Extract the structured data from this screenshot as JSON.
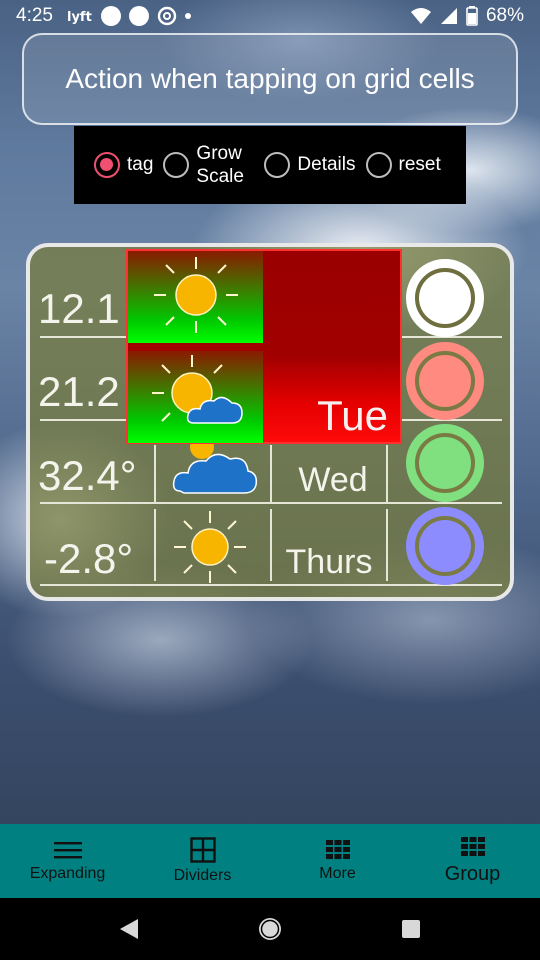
{
  "status_bar": {
    "time": "4:25",
    "battery": "68%",
    "icons": [
      "lyft-icon",
      "circle-icon",
      "circle-icon",
      "at-icon",
      "dot-icon",
      "wifi-icon",
      "signal-icon",
      "battery-icon"
    ]
  },
  "header": {
    "title": "Action when tapping on grid cells"
  },
  "actions": {
    "options": [
      {
        "label": "tag",
        "checked": true
      },
      {
        "label": "Grow Scale",
        "checked": false
      },
      {
        "label": "Details",
        "checked": false
      },
      {
        "label": "reset",
        "checked": false
      }
    ],
    "accent_color": "#f05070"
  },
  "weather_grid": {
    "rows": [
      {
        "temp": "12.1",
        "icon": "sun-icon",
        "day": "",
        "ring_color": "#ffffff"
      },
      {
        "temp": "21.2",
        "icon": "sun-cloud-icon",
        "day": "",
        "ring_color": "#ff8a80"
      },
      {
        "temp": "32.4°",
        "icon": "cloud-icon",
        "day": "Wed",
        "ring_color": "#80e080"
      },
      {
        "temp": "-2.8°",
        "icon": "sun-icon",
        "day": "Thurs",
        "ring_color": "#8c8cff"
      }
    ],
    "expanded_day": "Tue",
    "panel_color": "#787d3c"
  },
  "bottom_nav": {
    "items": [
      {
        "label": "Expanding",
        "icon": "hamburger-icon"
      },
      {
        "label": "Dividers",
        "icon": "grid-2x2-icon"
      },
      {
        "label": "More",
        "icon": "grid-3x3-icon"
      },
      {
        "label": "Group",
        "icon": "grid-3x3-icon"
      }
    ],
    "active_index": 3,
    "bg_color": "#008080"
  },
  "system_nav": {
    "buttons": [
      "back-icon",
      "home-icon",
      "recents-icon"
    ]
  }
}
